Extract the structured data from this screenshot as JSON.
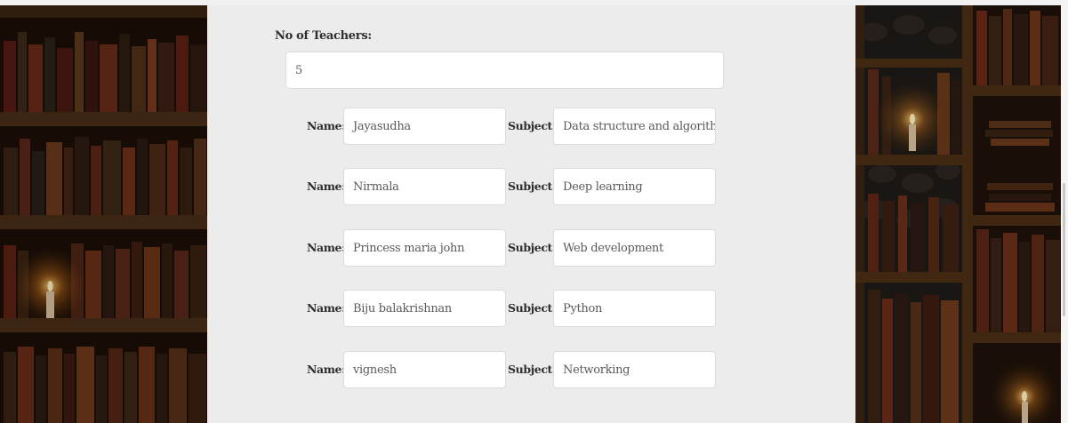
{
  "form": {
    "teacher_count_label": "No of Teachers:",
    "teacher_count_value": "5",
    "name_label": "Name:",
    "subject_label": "Subject:",
    "teachers": [
      {
        "name": "Jayasudha",
        "subject": "Data structure and algorithr"
      },
      {
        "name": "Nirmala",
        "subject": "Deep learning"
      },
      {
        "name": "Princess maria john",
        "subject": "Web development"
      },
      {
        "name": "Biju balakrishnan",
        "subject": "Python"
      },
      {
        "name": "vignesh",
        "subject": "Networking"
      }
    ]
  },
  "theme": {
    "page_background": "#ececec",
    "input_background": "#ffffff",
    "input_border": "#dcdcdc",
    "label_color": "#2f2f2f",
    "side_panel_image": "library-bookshelf-candle"
  }
}
